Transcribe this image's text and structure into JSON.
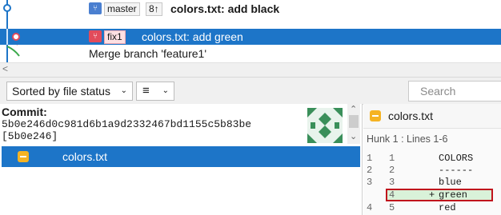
{
  "commits": [
    {
      "branch": "master",
      "count": "8↑",
      "message": "colors.txt: add black"
    },
    {
      "branch": "fix1",
      "message": "colors.txt: add green"
    },
    {
      "message": "Merge branch 'feature1'"
    }
  ],
  "toolbar": {
    "sort_label": "Sorted by file status",
    "view_icon": "list-icon",
    "search_placeholder": "Search"
  },
  "commit_info": {
    "label": "Commit:",
    "hash": "5b0e246d0c981d6b1a9d2332467bd1155c5b83be",
    "short_hash": "[5b0e246]"
  },
  "files": [
    {
      "name": "colors.txt",
      "status": "modified"
    }
  ],
  "diff": {
    "file": "colors.txt",
    "hunk": "Hunk 1 : Lines 1-6",
    "lines": [
      {
        "old": "1",
        "new": "1",
        "sign": "",
        "text": "COLORS"
      },
      {
        "old": "2",
        "new": "2",
        "sign": "",
        "text": "------"
      },
      {
        "old": "3",
        "new": "3",
        "sign": "",
        "text": "blue"
      },
      {
        "old": "",
        "new": "4",
        "sign": "+",
        "text": "green"
      },
      {
        "old": "4",
        "new": "5",
        "sign": "",
        "text": "red"
      }
    ]
  },
  "colors": {
    "selection": "#1d75c8",
    "added_bg": "#d9f2d9",
    "highlight_border": "#c0141c",
    "file_icon": "#f5b323"
  }
}
